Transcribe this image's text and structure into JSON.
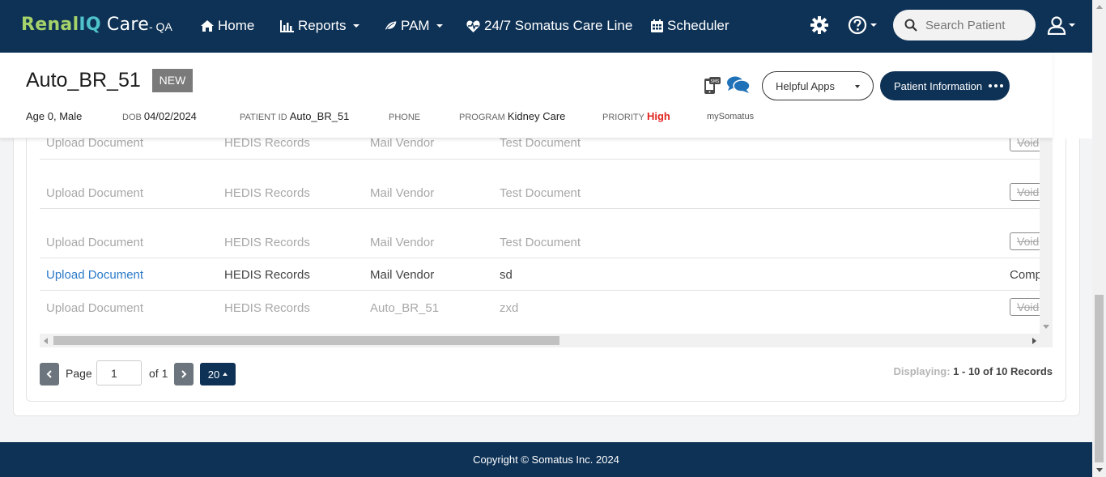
{
  "brand": {
    "part1": "Renal",
    "part2": "IQ",
    "part3": "Care",
    "env": "- QA"
  },
  "nav": {
    "home": "Home",
    "reports": "Reports",
    "pam": "PAM",
    "careline": "24/7 Somatus Care Line",
    "scheduler": "Scheduler"
  },
  "search": {
    "placeholder": "Search Patient"
  },
  "patient": {
    "name": "Auto_BR_51",
    "badge": "NEW",
    "age_sex": "Age 0, Male",
    "dob_label": "DOB",
    "dob": "04/02/2024",
    "id_label": "PATIENT ID",
    "id": "Auto_BR_51",
    "phone_label": "PHONE",
    "program_label": "PROGRAM",
    "program": "Kidney Care",
    "priority_label": "PRIORITY",
    "priority": "High",
    "mysomatus": "mySomatus"
  },
  "actions": {
    "helpful_apps": "Helpful Apps",
    "patient_info": "Patient Information",
    "sms_label": "SMS"
  },
  "table": {
    "rows": [
      {
        "type": "Upload Document",
        "category": "HEDIS Records",
        "source": "Mail Vendor",
        "name": "Test Document",
        "status": "Void",
        "faded": true
      },
      {
        "type": "Upload Document",
        "category": "HEDIS Records",
        "source": "Mail Vendor",
        "name": "Test Document",
        "status": "Void",
        "faded": true
      },
      {
        "type": "Upload Document",
        "category": "HEDIS Records",
        "source": "Mail Vendor",
        "name": "Test Document",
        "status": "Void",
        "faded": true
      },
      {
        "type": "Upload Document",
        "category": "HEDIS Records",
        "source": "Mail Vendor",
        "name": "sd",
        "status": "Comp",
        "faded": false
      },
      {
        "type": "Upload Document",
        "category": "HEDIS Records",
        "source": "Auto_BR_51",
        "name": "zxd",
        "status": "Void",
        "faded": true
      }
    ]
  },
  "pagination": {
    "page_label": "Page",
    "page_value": "1",
    "of_label": "of 1",
    "page_size": "20",
    "displaying_label": "Displaying:",
    "displaying_value": "1 - 10 of 10 Records"
  },
  "footer": {
    "copyright": "Copyright © Somatus Inc. 2024"
  },
  "colors": {
    "navy": "#0e3256",
    "brand_green": "#a5d36a",
    "brand_teal": "#4fc3c9",
    "priority_red": "#e0241f",
    "link_blue": "#2c7ac9"
  }
}
